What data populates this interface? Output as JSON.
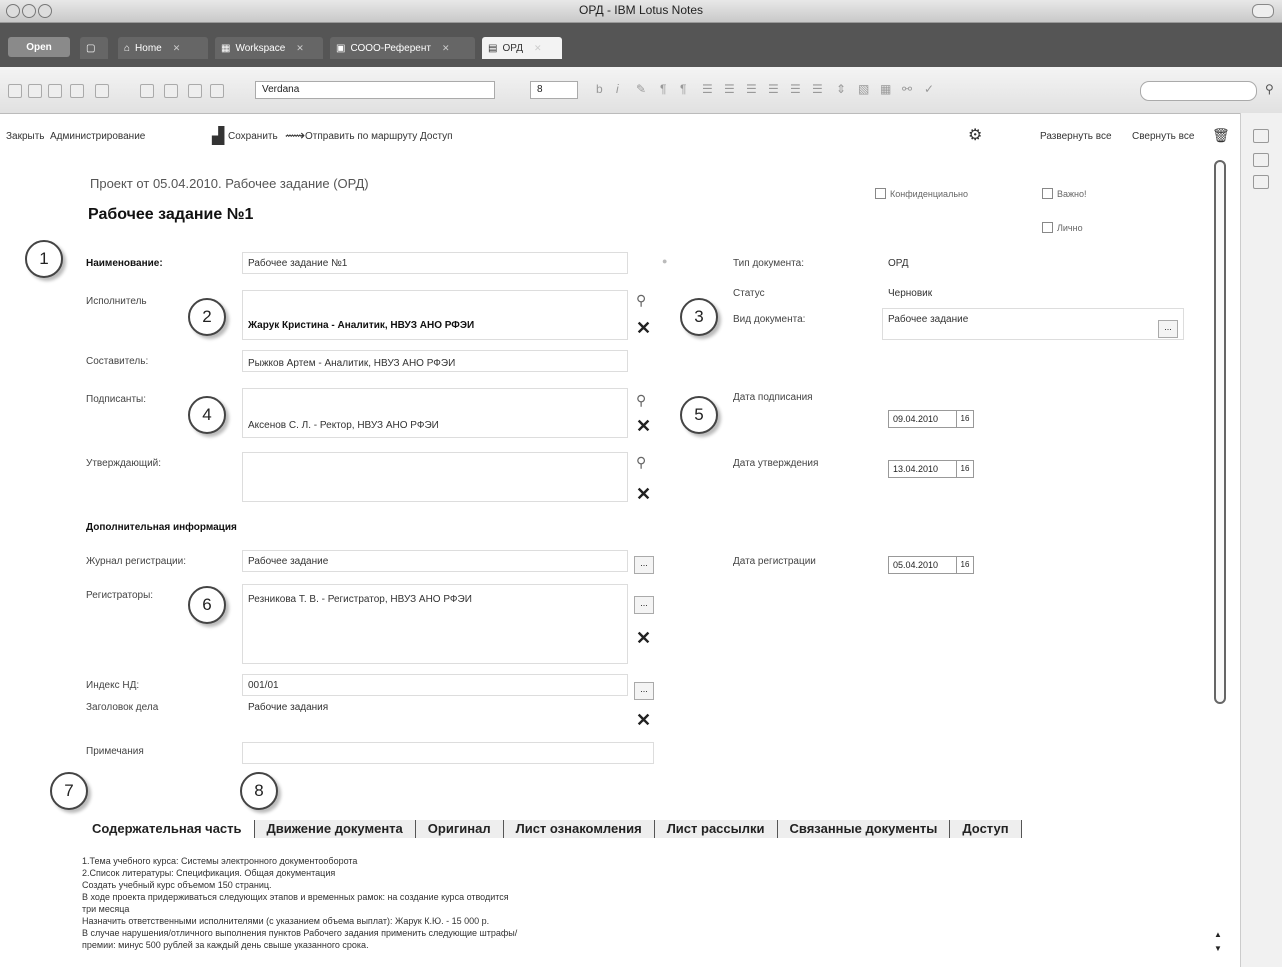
{
  "window": {
    "title": "ОРД - IBM Lotus Notes"
  },
  "tabs": [
    {
      "label": "Home"
    },
    {
      "label": "Workspace"
    },
    {
      "label": "СООО-Референт"
    },
    {
      "label": "ОРД"
    }
  ],
  "open_button": "Open",
  "toolbar": {
    "font": "Verdana",
    "size": "8"
  },
  "actions": {
    "close": "Закрыть",
    "admin": "Администрирование",
    "save": "Сохранить",
    "route": "Отправить по маршруту",
    "access": "Доступ",
    "expand_all": "Развернуть все",
    "collapse_all": "Свернуть все"
  },
  "doc": {
    "subtitle": "Проект от 05.04.2010. Рабочее задание (ОРД)",
    "title": "Рабочее задание №1"
  },
  "checks": {
    "confidential": "Конфиденциально",
    "important": "Важно!",
    "personal": "Лично"
  },
  "form": {
    "name_label": "Наименование:",
    "name_value": "Рабочее задание №1",
    "executor_label": "Исполнитель",
    "executor_value": "Жарук Кристина - Аналитик, НВУЗ АНО РФЭИ",
    "author_label": "Составитель:",
    "author_value": "Рыжков Артем - Аналитик, НВУЗ АНО РФЭИ",
    "signers_label": "Подписанты:",
    "signers_value": "Аксенов С. Л. - Ректор, НВУЗ АНО РФЭИ",
    "approver_label": "Утверждающий:",
    "doctype_label": "Тип документа:",
    "doctype_value": "ОРД",
    "status_label": "Статус",
    "status_value": "Черновик",
    "kind_label": "Вид документа:",
    "kind_value": "Рабочее задание",
    "sign_date_label": "Дата подписания",
    "sign_date": "09.04.2010",
    "approve_date_label": "Дата утверждения",
    "approve_date": "13.04.2010",
    "extra_section": "Дополнительная информация",
    "journal_label": "Журнал регистрации:",
    "journal_value": "Рабочее задание",
    "reg_date_label": "Дата регистрации",
    "reg_date": "05.04.2010",
    "registrars_label": "Регистраторы:",
    "registrars_value": "Резникова Т. В. - Регистратор, НВУЗ АНО РФЭИ",
    "index_label": "Индекс НД:",
    "index_value": "001/01",
    "case_label": "Заголовок дела",
    "case_value": "Рабочие задания",
    "notes_label": "Примечания"
  },
  "doc_tabs": [
    "Содержательная часть",
    "Движение документа",
    "Оригинал",
    "Лист ознакомления",
    "Лист рассылки",
    "Связанные документы",
    "Доступ"
  ],
  "content_lines": [
    "1.Тема учебного курса: Системы электронного документооборота",
    "2.Список литературы: Спецификация. Общая документация",
    "Создать учебный курс объемом 150 страниц.",
    "В ходе проекта придерживаться следующих этапов и временных рамок: на создание курса отводится",
    "три месяца",
    "Назначить ответственными исполнителями (с указанием объема выплат): Жарук К.Ю. - 15 000 р.",
    "В случае нарушения/отличного выполнения пунктов Рабочего задания применить следующие штрафы/",
    "премии: минус 500 рублей за каждый день свыше указанного срока."
  ],
  "callouts": [
    "1",
    "2",
    "3",
    "4",
    "5",
    "6",
    "7",
    "8"
  ],
  "calendar_icon_text": "16",
  "more_button_text": "..."
}
